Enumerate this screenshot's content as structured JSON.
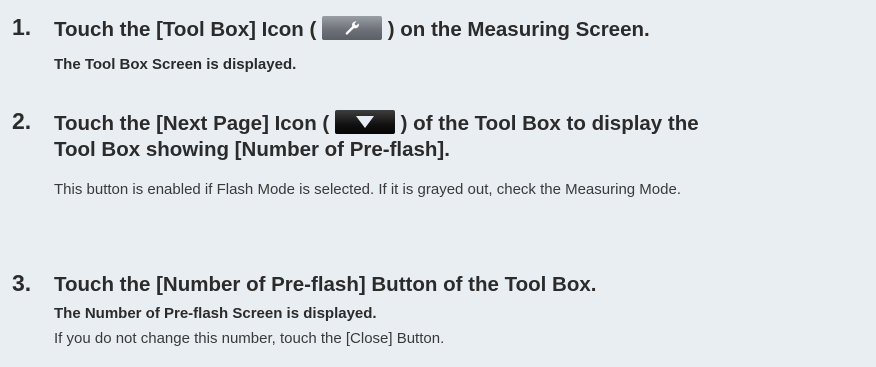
{
  "steps": [
    {
      "number": "1.",
      "title_before": "Touch the [Tool Box] Icon (",
      "icon": "wrench-icon",
      "title_after": ") on the Measuring Screen.",
      "result": "The Tool Box Screen is displayed."
    },
    {
      "number": "2.",
      "title_before": "Touch the [Next Page] Icon (",
      "icon": "down-triangle-icon",
      "title_after": ") of the Tool Box to display the",
      "title_line2": "Tool Box showing [Number of Pre-flash].",
      "note": "This button is enabled if Flash Mode is selected. If it is grayed out, check the Measuring Mode."
    },
    {
      "number": "3.",
      "title": "Touch the [Number of Pre-flash] Button of the Tool Box.",
      "result": "The Number of Pre-flash Screen is displayed.",
      "note": "If you do not change this number, touch the [Close] Button."
    }
  ],
  "colors": {
    "background": "#e9eef2",
    "text": "#2b2b2b"
  }
}
